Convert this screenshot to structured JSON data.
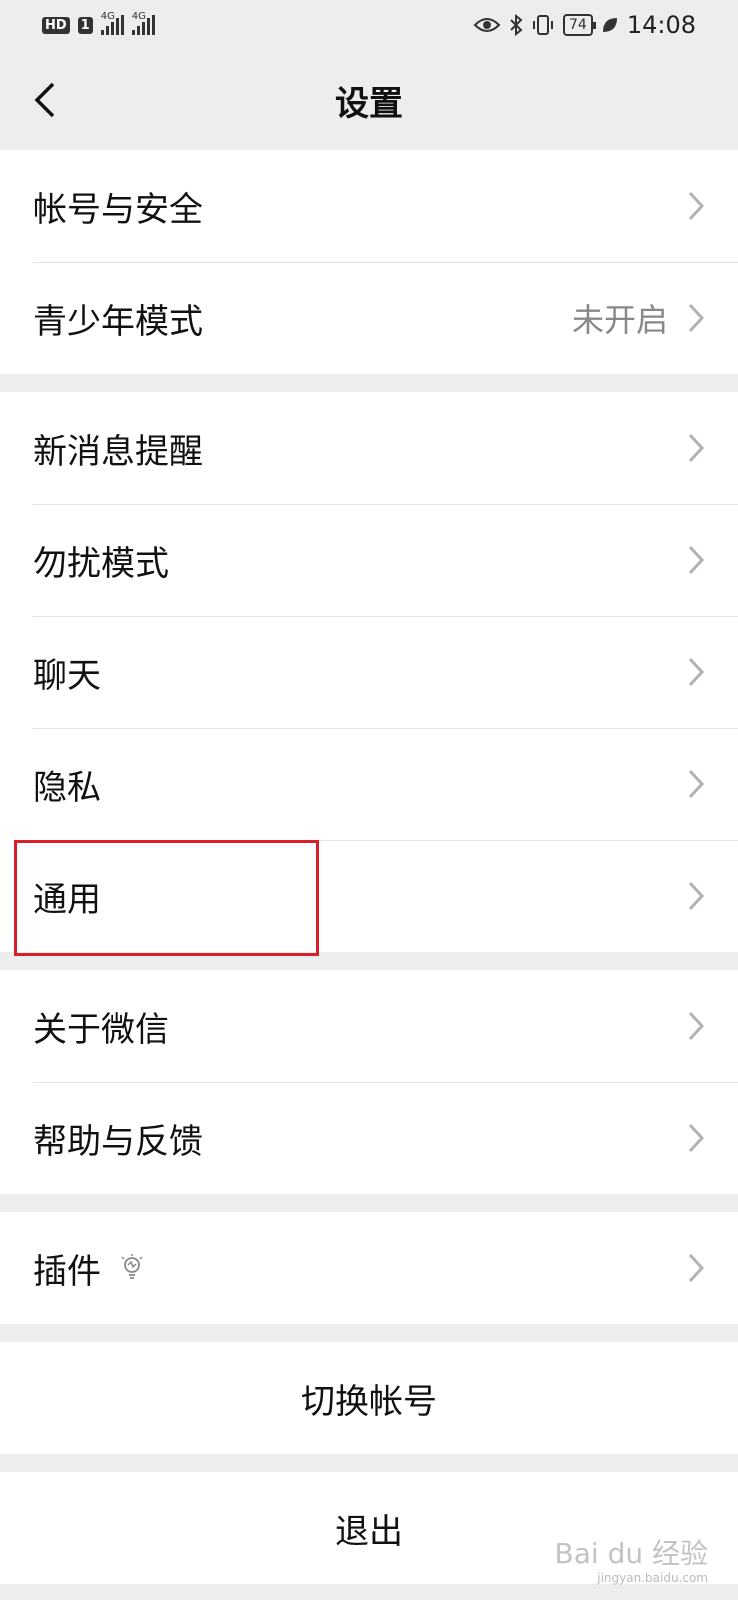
{
  "status_bar": {
    "hd": "HD",
    "sim1": "1",
    "net1": "4G",
    "net2": "4G",
    "battery": "74",
    "time": "14:08"
  },
  "nav": {
    "title": "设置"
  },
  "groups": [
    {
      "items": [
        {
          "label": "帐号与安全"
        },
        {
          "label": "青少年模式",
          "value": "未开启"
        }
      ]
    },
    {
      "items": [
        {
          "label": "新消息提醒"
        },
        {
          "label": "勿扰模式"
        },
        {
          "label": "聊天"
        },
        {
          "label": "隐私"
        },
        {
          "label": "通用"
        }
      ]
    },
    {
      "items": [
        {
          "label": "关于微信"
        },
        {
          "label": "帮助与反馈"
        }
      ]
    },
    {
      "items": [
        {
          "label": "插件"
        }
      ]
    }
  ],
  "actions": {
    "switch_account": "切换帐号",
    "logout": "退出"
  },
  "watermark": {
    "brand": "Bai du 经验",
    "url": "jingyan.baidu.com"
  },
  "colors": {
    "highlight": "#d9202a",
    "background": "#ededed"
  }
}
